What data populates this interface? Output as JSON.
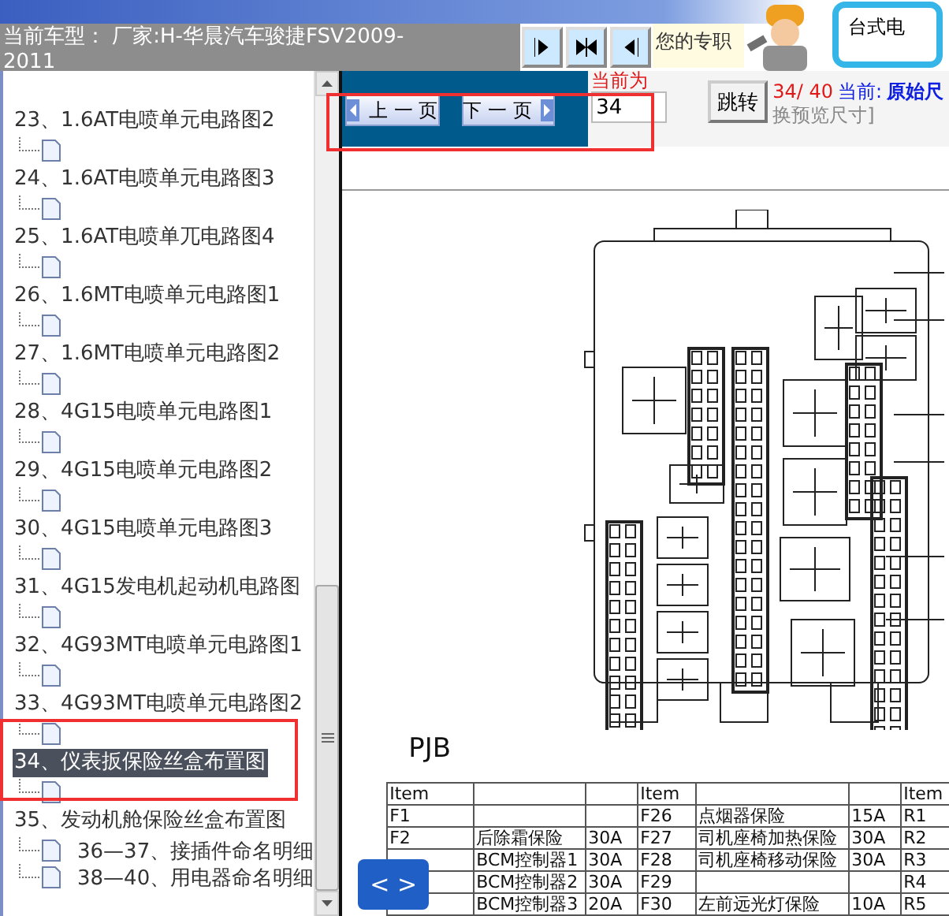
{
  "header": {
    "vehicle_label": "当前车型：",
    "vehicle": "厂家:H-华晨汽车骏捷FSV2009-2011",
    "promo": "您的专职",
    "promo_box": "台式电"
  },
  "tree": {
    "items": [
      {
        "label": "23、1.6AT电喷单元电路图2",
        "kind": "page",
        "selected": false
      },
      {
        "label": "24、1.6AT电喷单元电路图3",
        "kind": "page",
        "selected": false
      },
      {
        "label": "25、1.6AT电喷单兀电路图4",
        "kind": "page",
        "selected": false
      },
      {
        "label": "26、1.6MT电喷单元电路图1",
        "kind": "page",
        "selected": false
      },
      {
        "label": "27、1.6MT电喷单元电路图2",
        "kind": "page",
        "selected": false
      },
      {
        "label": "28、4G15电喷单元电路图1",
        "kind": "page",
        "selected": false
      },
      {
        "label": "29、4G15电喷单元电路图2",
        "kind": "page",
        "selected": false
      },
      {
        "label": "30、4G15电喷单元电路图3",
        "kind": "page",
        "selected": false
      },
      {
        "label": "31、4G15发电机起动机电路图",
        "kind": "page",
        "selected": false
      },
      {
        "label": "32、4G93MT电喷单元电路图1",
        "kind": "page",
        "selected": false
      },
      {
        "label": "33、4G93MT电喷单元电路图2",
        "kind": "page",
        "selected": false
      },
      {
        "label": "34、仪表扳保险丝盒布置图",
        "kind": "page",
        "selected": true
      },
      {
        "label": "35、发动机舱保险丝盒布置图",
        "kind": "folder",
        "selected": false,
        "children": [
          {
            "label": "36—37、接插件命名明细",
            "selected": false
          },
          {
            "label": "38—40、用电器命名明细",
            "selected": false
          }
        ]
      }
    ]
  },
  "pager": {
    "prev": "上 一 页",
    "next": "下 一 页",
    "page_label": "当前为",
    "page_value": "34",
    "go": "跳转",
    "counter": "34/ 40",
    "current_label": "当前:",
    "current_value": "原始尺",
    "hint": "换预览尺寸]"
  },
  "document": {
    "diagram_label": "PJB",
    "table": {
      "headers": [
        "Item",
        "Item",
        "Item"
      ],
      "rows": [
        {
          "a_item": "F1",
          "b_item": "F26",
          "b_name": "点烟器保险",
          "b_rating": "15A",
          "c_item": "R1"
        },
        {
          "a_item": "F2",
          "a_name": "后除霜保险",
          "a_rating": "30A",
          "b_item": "F27",
          "b_name": "司机座椅加热保险",
          "b_rating": "30A",
          "c_item": "R2"
        },
        {
          "a_name": "BCM控制器1",
          "a_rating": "30A",
          "b_item": "F28",
          "b_name": "司机座椅移动保险",
          "b_rating": "30A",
          "c_item": "R3"
        },
        {
          "a_name": "BCM控制器2",
          "a_rating": "30A",
          "b_item": "F29",
          "c_item": "R4"
        },
        {
          "a_name": "BCM控制器3",
          "a_rating": "20A",
          "b_item": "F30",
          "b_name": "左前远光灯保险",
          "b_rating": "10A",
          "c_item": "R5"
        }
      ]
    }
  },
  "float_button": "< >"
}
